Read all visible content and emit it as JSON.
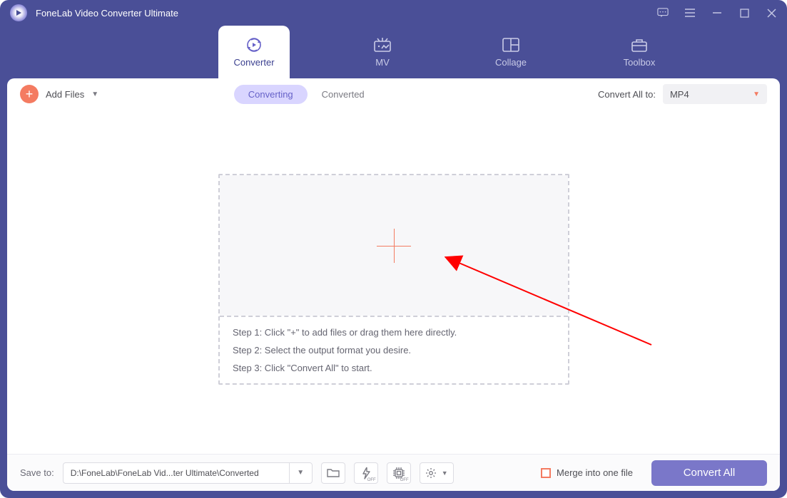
{
  "window": {
    "title": "FoneLab Video Converter Ultimate"
  },
  "nav_tabs": {
    "converter": "Converter",
    "mv": "MV",
    "collage": "Collage",
    "toolbox": "Toolbox",
    "active": "converter"
  },
  "subbar": {
    "add_files_label": "Add Files",
    "tab_converting": "Converting",
    "tab_converted": "Converted",
    "active_tab": "converting",
    "convert_all_to_label": "Convert All to:",
    "selected_format": "MP4"
  },
  "dropzone": {
    "step1": "Step 1: Click \"+\" to add files or drag them here directly.",
    "step2": "Step 2: Select the output format you desire.",
    "step3": "Step 3: Click \"Convert All\" to start."
  },
  "footer": {
    "save_to_label": "Save to:",
    "save_path": "D:\\FoneLab\\FoneLab Vid...ter Ultimate\\Converted",
    "merge_label": "Merge into one file",
    "merge_checked": false,
    "convert_all_button": "Convert All"
  },
  "icons": {
    "off_badge": "OFF"
  },
  "colors": {
    "brand_purple": "#4a4f97",
    "brand_light_purple": "#7a77c9",
    "accent_orange": "#f47b61",
    "pill_active": "#d9d5ff"
  }
}
